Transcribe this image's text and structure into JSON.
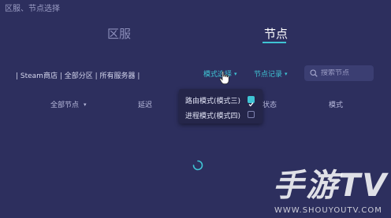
{
  "window": {
    "title": "区服、节点选择"
  },
  "tabs": [
    {
      "label": "区服",
      "active": false
    },
    {
      "label": "节点",
      "active": true
    }
  ],
  "filter": {
    "text": "| Steam商店 | 全部分区 | 所有服务器 |"
  },
  "toolbar": {
    "mode_select_label": "模式选择",
    "node_record_label": "节点记录"
  },
  "search": {
    "placeholder": "搜索节点",
    "value": ""
  },
  "columns": {
    "all_nodes": "全部节点",
    "latency": "延迟",
    "status": "状态",
    "mode": "模式"
  },
  "mode_menu": {
    "items": [
      {
        "label": "路由模式(模式三)",
        "checked": true
      },
      {
        "label": "进程模式(模式四)",
        "checked": false
      }
    ]
  },
  "watermark": {
    "text": "手游TV",
    "url": "WWW.SHOUYOUTV.COM"
  },
  "colors": {
    "background": "#2d2f5e",
    "accent": "#3fc4d4",
    "popup": "#25264a"
  },
  "icons": [
    "search-icon",
    "chevron-down-icon",
    "checkbox-checked-icon",
    "checkbox-empty-icon",
    "hand-cursor-icon",
    "loading-spinner-icon"
  ]
}
